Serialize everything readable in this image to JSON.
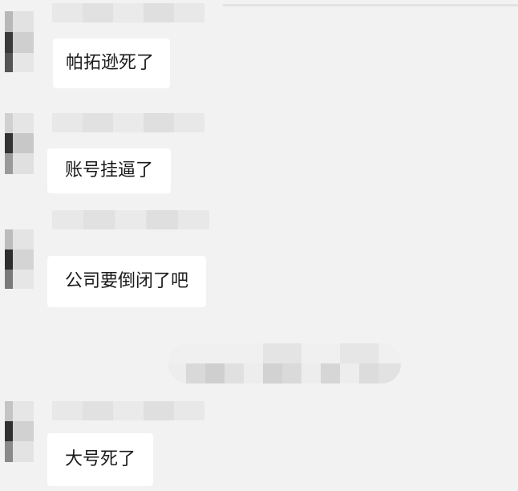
{
  "chat": {
    "messages": [
      {
        "text": "帕拓逊死了"
      },
      {
        "text": "账号挂逼了"
      },
      {
        "text": "公司要倒闭了吧"
      },
      {
        "text": "大号死了"
      }
    ]
  },
  "colors": {
    "background": "#f2f2f2",
    "bubble": "#ffffff",
    "text": "#1b1b1b"
  }
}
